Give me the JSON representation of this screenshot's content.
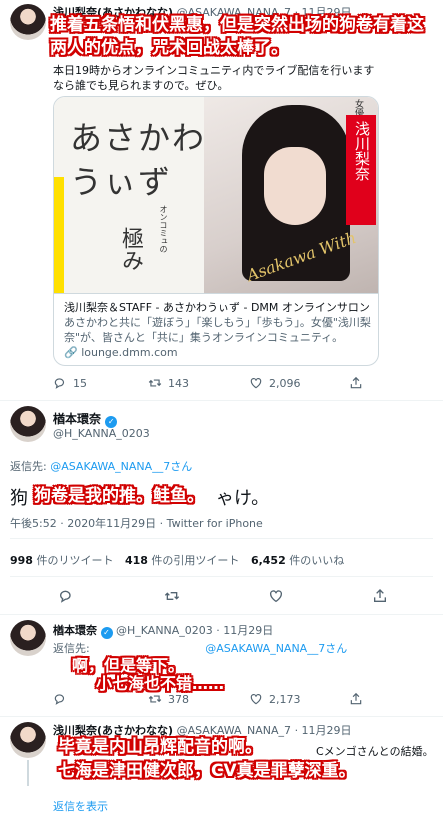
{
  "overlays": {
    "top": "推着五条悟和伏黑惠，但是突然出场的狗卷有着这两人的优点，咒术回战太棒了。",
    "reply": "狗卷是我的推。鲑鱼。",
    "small_line1": "啊，但是等下。",
    "small_line2": "小七海也不错……",
    "bottom_line1": "毕竟是内山昂辉配音的啊。",
    "bottom_line2": "七海是津田健次郎，CV真是罪孽深重。"
  },
  "tweet1": {
    "author": "浅川梨奈(あさかわなな)",
    "handle": "@ASAKAWA_NANA_7",
    "date": "· 11月29日",
    "body_line2": "本日19時からオンラインコミュニティ内でライブ配信を行います",
    "body_line3": "なら誰でも見られますので。ぜひ。",
    "card": {
      "title_line1": "あさかわ",
      "title_line2": "うぃず",
      "vertical_sub": "オンコミュの",
      "kiwami": "極み",
      "role": "女優",
      "name_vertical": "浅川梨奈",
      "signature": "Asakawa With",
      "link_title": "浅川梨奈＆STAFF - あさかわうぃず - DMM オンラインサロン",
      "desc_line1": "あさかわと共に「遊ぼう」「楽しもう」「歩もう」。女優\"浅川梨",
      "desc_line2": "奈\"が、皆さんと「共に」集うオンラインコミュニティ。",
      "domain": "lounge.dmm.com"
    },
    "stats": {
      "replies": "15",
      "retweets": "143",
      "likes": "2,096"
    }
  },
  "main_tweet": {
    "author": "楢本環奈",
    "handle": "@H_KANNA_0203",
    "reply_prefix": "返信先: ",
    "reply_to": "@ASAKAWA_NANA__7さん",
    "body_start": "狗",
    "body_end": "ゃけ。",
    "time": "午後5:52 · 2020年11月29日 · Twitter for iPhone",
    "retweet_count": "998",
    "retweet_label": " 件のリツイート",
    "quote_count": "418",
    "quote_label": " 件の引用ツイート",
    "like_count": "6,452",
    "like_label": " 件のいいね"
  },
  "reply1": {
    "author": "楢本環奈",
    "handle": "@H_KANNA_0203",
    "date": "· 11月29日",
    "reply_prefix": "返信先:",
    "reply_to": "@ASAKAWA_NANA__7さん",
    "stats": {
      "retweets": "378",
      "likes": "2,173"
    }
  },
  "reply2": {
    "author": "浅川梨奈(あさかわなな)",
    "handle": "@ASAKAWA_NANA_7",
    "date": "· 11月29日",
    "body_tail": "Cメンゴさんとの結婚。",
    "show_replies": "返信を表示"
  }
}
